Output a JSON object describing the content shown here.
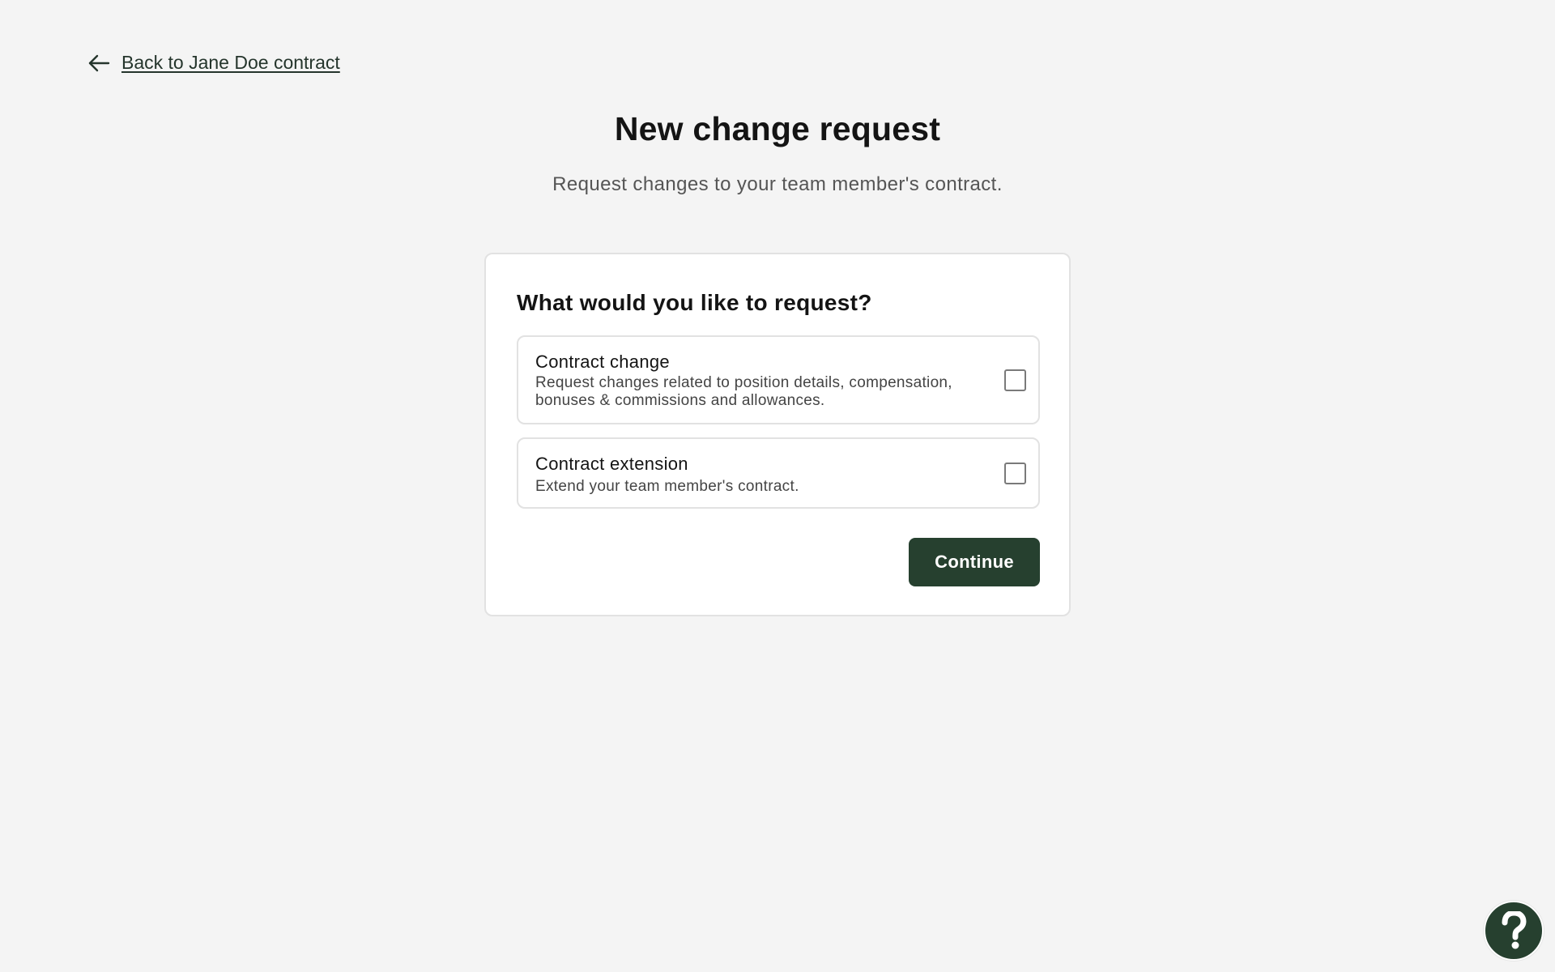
{
  "nav": {
    "back_label": "Back to Jane Doe contract",
    "back_icon": "arrow-left-icon"
  },
  "header": {
    "title": "New change request",
    "subtitle": "Request changes to your team member's contract."
  },
  "card": {
    "title": "What would you like to request?",
    "options": [
      {
        "title": "Contract change",
        "description": "Request changes related to position details, compensation, bonuses & commissions and allowances.",
        "checked": false
      },
      {
        "title": "Contract extension",
        "description": "Extend your team member's contract.",
        "checked": false
      }
    ],
    "continue_label": "Continue"
  },
  "help": {
    "icon": "question-mark-icon"
  },
  "colors": {
    "background": "#f4f4f4",
    "primary": "#26402f",
    "card": "#ffffff",
    "border": "#e2e2e2"
  }
}
